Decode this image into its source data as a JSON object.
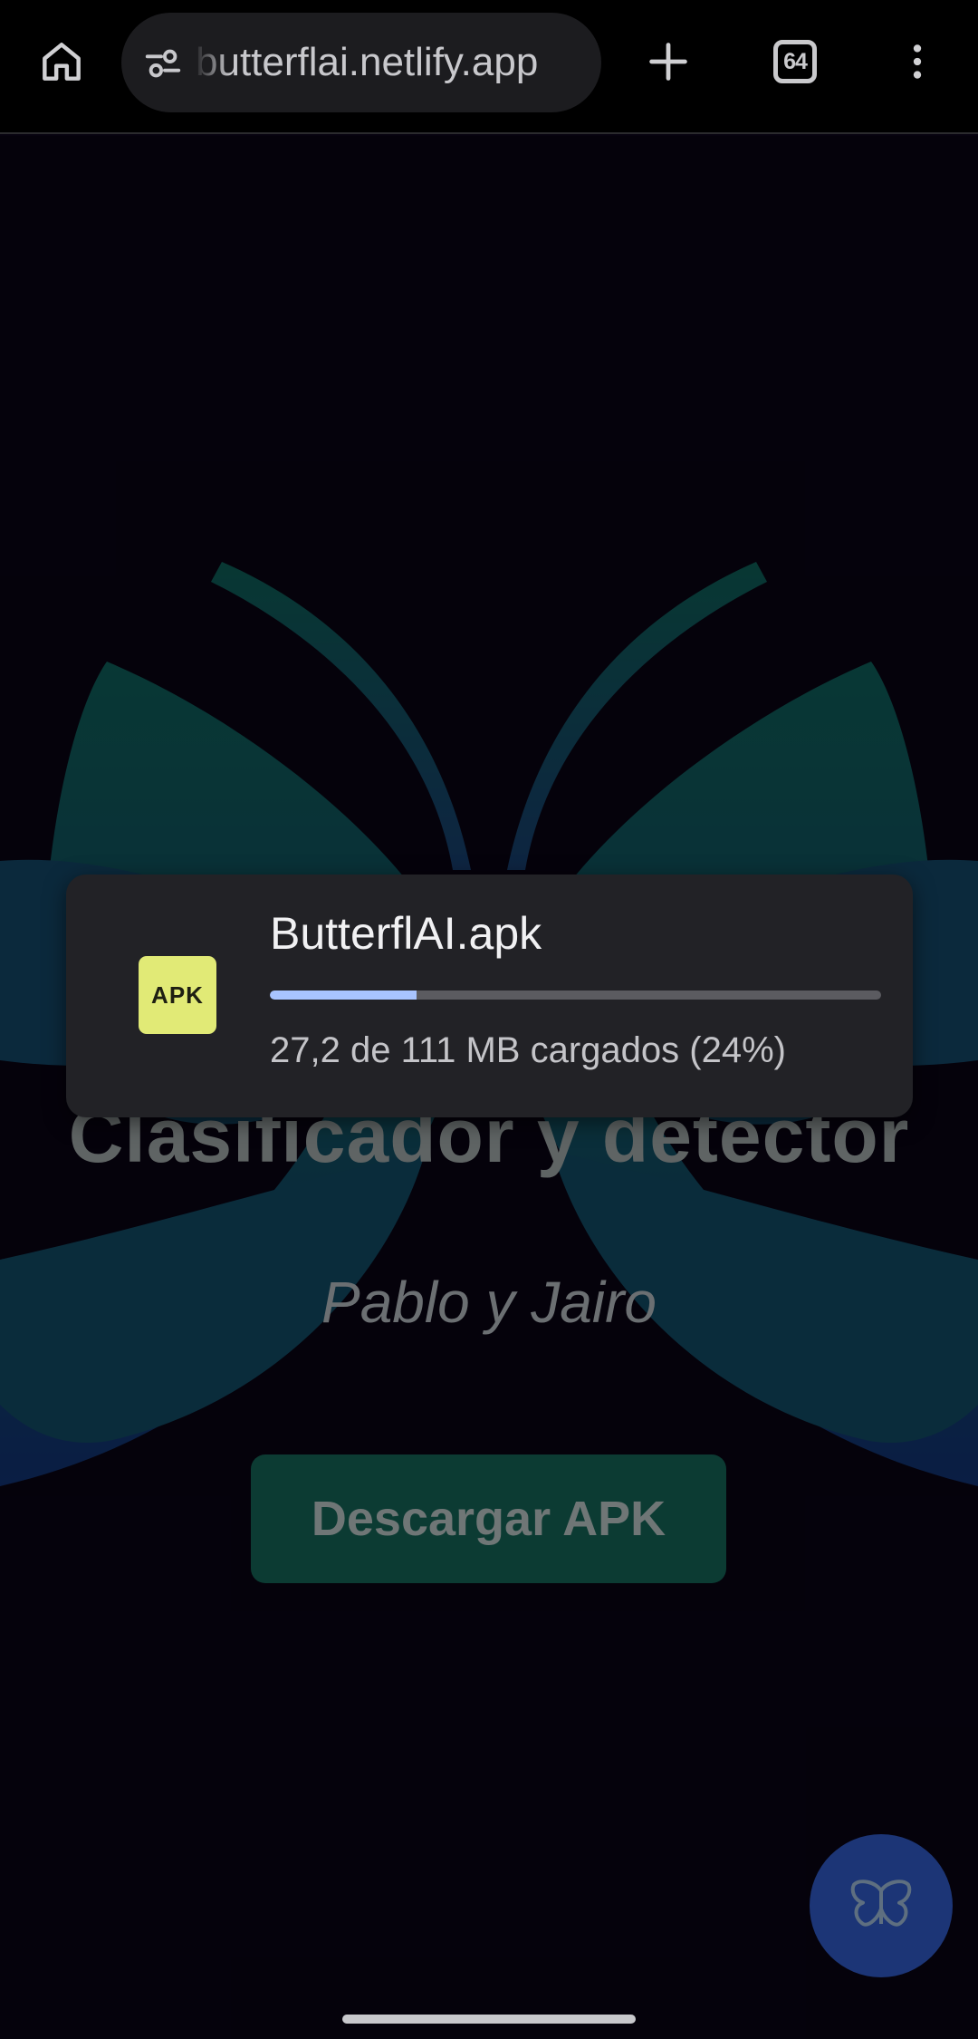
{
  "browser": {
    "url": "butterflai.netlify.app",
    "tab_count": "64",
    "icons": {
      "home": "home-icon",
      "site_settings": "tune-icon",
      "new_tab": "plus-icon",
      "tabs": "tab-switcher-icon",
      "menu": "more-vert-icon"
    }
  },
  "page": {
    "title": "Clasificador y detector",
    "authors": "Pablo y Jairo",
    "download_button": "Descargar APK",
    "fab_icon": "butterfly-icon"
  },
  "download_toast": {
    "badge": "APK",
    "file_name": "ButterflAI.apk",
    "progress": 0.24,
    "status": "27,2 de 111 MB cargados (24%)"
  },
  "colors": {
    "background": "#07030f",
    "toast": "#222226",
    "progress": "#a8c4ff",
    "apk_badge": "#e1ea76",
    "fab": "#1c3576"
  }
}
